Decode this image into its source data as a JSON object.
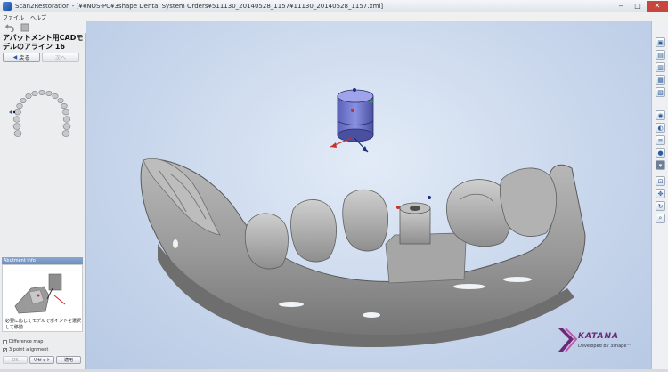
{
  "window": {
    "title": "Scan2Restoration - [¥¥NOS-PC¥3shape Dental System Orders¥511130_20140528_1157¥11130_20140528_1157.xml]",
    "minimize": "‒",
    "maximize": "□",
    "close": "✕"
  },
  "menu": {
    "items": [
      "ファイル",
      "ヘルプ"
    ]
  },
  "left_panel": {
    "title": "アバットメント用CADモデルのアライン 16",
    "back_label": "戻る",
    "next_label": "次へ",
    "info_header": "Abutment info",
    "info_text": "必要に応じてモデルでポイントを選択して移動",
    "difference_map_label": "Difference map",
    "difference_map_checked": false,
    "three_point_label": "3 point alignment",
    "three_point_checked": true,
    "three_point_mark": "✓",
    "ok_label": "OK",
    "reset_label": "リセット",
    "apply_label": "適用"
  },
  "logo": {
    "brand": "KATANA",
    "tagline": "Developed by 3shape™"
  },
  "icons": {
    "back": "arrow-left-icon",
    "next": "arrow-right-icon",
    "tool_undo": "undo-icon",
    "tool_redo": "redo-icon"
  },
  "colors": {
    "viewport_bg": "#c9d7ec",
    "model_gray": "#9e9e9e",
    "abutment_blue": "#6a70c8",
    "brand_purple": "#6a2a78",
    "axis_red": "#c8302a",
    "axis_blue": "#1a2f7a",
    "axis_green": "#2a9a3a"
  }
}
